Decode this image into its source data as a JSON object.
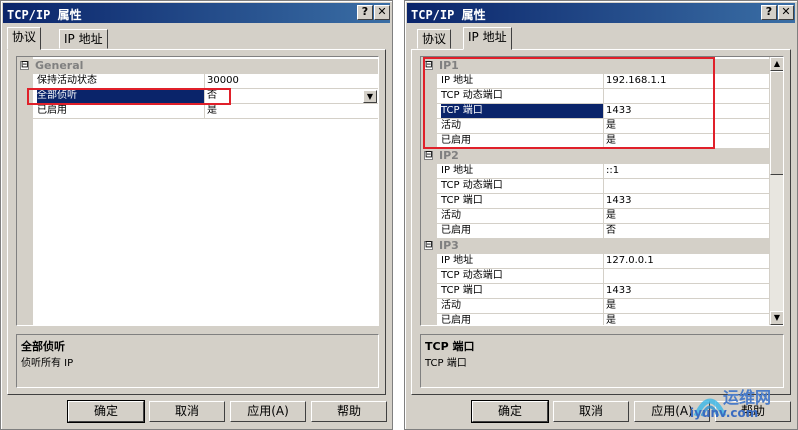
{
  "left": {
    "title": "TCP/IP 属性",
    "help_glyph": "?",
    "close_glyph": "✕",
    "tabs": [
      {
        "label": "协议"
      },
      {
        "label": "IP 地址"
      }
    ],
    "category": "General",
    "expander": "⊟",
    "rows": [
      {
        "name": "保持活动状态",
        "value": "30000"
      },
      {
        "name": "全部侦听",
        "value": "否"
      },
      {
        "name": "已启用",
        "value": "是"
      }
    ],
    "dropdown_glyph": "▼",
    "desc_title": "全部侦听",
    "desc_text": "侦听所有 IP",
    "buttons": {
      "ok": "确定",
      "cancel": "取消",
      "apply": "应用(A)",
      "help": "帮助"
    }
  },
  "right": {
    "title": "TCP/IP 属性",
    "help_glyph": "?",
    "close_glyph": "✕",
    "tabs": [
      {
        "label": "协议"
      },
      {
        "label": "IP 地址"
      }
    ],
    "expander": "⊟",
    "groups": [
      {
        "title": "IP1",
        "rows": [
          {
            "name": "IP 地址",
            "value": "192.168.1.1"
          },
          {
            "name": "TCP 动态端口",
            "value": ""
          },
          {
            "name": "TCP 端口",
            "value": "1433"
          },
          {
            "name": "活动",
            "value": "是"
          },
          {
            "name": "已启用",
            "value": "是"
          }
        ]
      },
      {
        "title": "IP2",
        "rows": [
          {
            "name": "IP 地址",
            "value": "::1"
          },
          {
            "name": "TCP 动态端口",
            "value": ""
          },
          {
            "name": "TCP 端口",
            "value": "1433"
          },
          {
            "name": "活动",
            "value": "是"
          },
          {
            "name": "已启用",
            "value": "否"
          }
        ]
      },
      {
        "title": "IP3",
        "rows": [
          {
            "name": "IP 地址",
            "value": "127.0.0.1"
          },
          {
            "name": "TCP 动态端口",
            "value": ""
          },
          {
            "name": "TCP 端口",
            "value": "1433"
          },
          {
            "name": "活动",
            "value": "是"
          },
          {
            "name": "已启用",
            "value": "是"
          }
        ]
      }
    ],
    "scroll_up": "▲",
    "scroll_down": "▼",
    "desc_title": "TCP 端口",
    "desc_text": "TCP 端口",
    "buttons": {
      "ok": "确定",
      "cancel": "取消",
      "apply": "应用(A)",
      "help": "帮助"
    }
  },
  "watermark": {
    "text": "运维网",
    "site": "iyunv.com"
  },
  "colors": {
    "selection": "#0a246a",
    "highlight_box": "#e0202a",
    "dialog": "#d4d0c8"
  }
}
